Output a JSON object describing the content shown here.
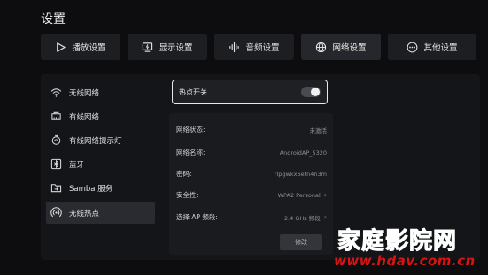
{
  "page": {
    "title": "设置"
  },
  "tabs": [
    {
      "label": "播放设置",
      "icon": "play-icon"
    },
    {
      "label": "显示设置",
      "icon": "display-icon"
    },
    {
      "label": "音频设置",
      "icon": "audio-wave-icon"
    },
    {
      "label": "网络设置",
      "icon": "globe-icon",
      "active": true
    },
    {
      "label": "其他设置",
      "icon": "more-icon"
    }
  ],
  "sidebar": {
    "items": [
      {
        "label": "无线网络",
        "icon": "wifi-icon"
      },
      {
        "label": "有线网络",
        "icon": "ethernet-icon"
      },
      {
        "label": "有线网络提示灯",
        "icon": "lightbulb-icon"
      },
      {
        "label": "蓝牙",
        "icon": "bluetooth-icon"
      },
      {
        "label": "Samba 服务",
        "icon": "folder-share-icon"
      },
      {
        "label": "无线热点",
        "icon": "hotspot-icon",
        "active": true
      }
    ]
  },
  "hotspot": {
    "toggle_label": "热点开关",
    "enabled": false
  },
  "info": {
    "rows": [
      {
        "label": "网络状态:",
        "value": "未激活",
        "chevron": false
      },
      {
        "label": "网络名称:",
        "value": "AndroidAP_5320",
        "chevron": false
      },
      {
        "label": "密码:",
        "value": "rlpgwkx6etn4n3m",
        "chevron": false
      },
      {
        "label": "安全性:",
        "value": "WPA2 Personal",
        "chevron": true
      },
      {
        "label": "选择 AP 频段:",
        "value": "2.4 GHz 频段",
        "chevron": true
      }
    ],
    "edit_label": "修改"
  },
  "watermark": {
    "title": "家庭影院网",
    "url": "www.hdav.com.cn"
  }
}
